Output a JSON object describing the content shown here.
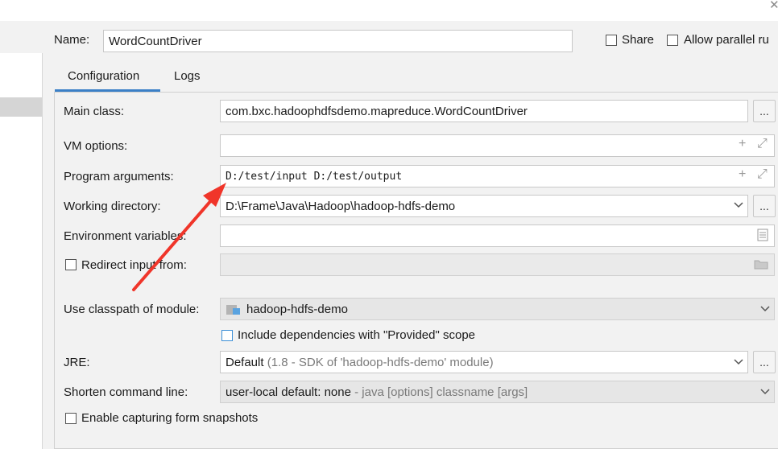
{
  "header": {
    "name_label": "Name:",
    "name_value": "WordCountDriver",
    "share_label": "Share",
    "allow_parallel_label": "Allow parallel ru"
  },
  "tabs": [
    {
      "label": "Configuration",
      "active": true
    },
    {
      "label": "Logs",
      "active": false
    }
  ],
  "form": {
    "main_class_label": "Main class:",
    "main_class_value": "com.bxc.hadoophdfsdemo.mapreduce.WordCountDriver",
    "vm_options_label": "VM options:",
    "vm_options_value": "",
    "program_args_label": "Program arguments:",
    "program_args_value": "D:/test/input D:/test/output",
    "working_dir_label": "Working directory:",
    "working_dir_value": "D:\\Frame\\Java\\Hadoop\\hadoop-hdfs-demo",
    "env_vars_label": "Environment variables:",
    "env_vars_value": "",
    "redirect_label": "Redirect input from:",
    "classpath_label": "Use classpath of module:",
    "classpath_value": "hadoop-hdfs-demo",
    "include_deps_label": "Include dependencies with \"Provided\" scope",
    "jre_label": "JRE:",
    "jre_value": "Default",
    "jre_hint": "(1.8 - SDK of 'hadoop-hdfs-demo' module)",
    "shorten_label": "Shorten command line:",
    "shorten_value": "user-local default: none",
    "shorten_hint": "- java [options] classname [args]",
    "snapshots_label": "Enable capturing form snapshots"
  },
  "buttons": {
    "browse": "..."
  },
  "colors": {
    "accent": "#3b80c7",
    "annotation_arrow": "#f0352a"
  }
}
